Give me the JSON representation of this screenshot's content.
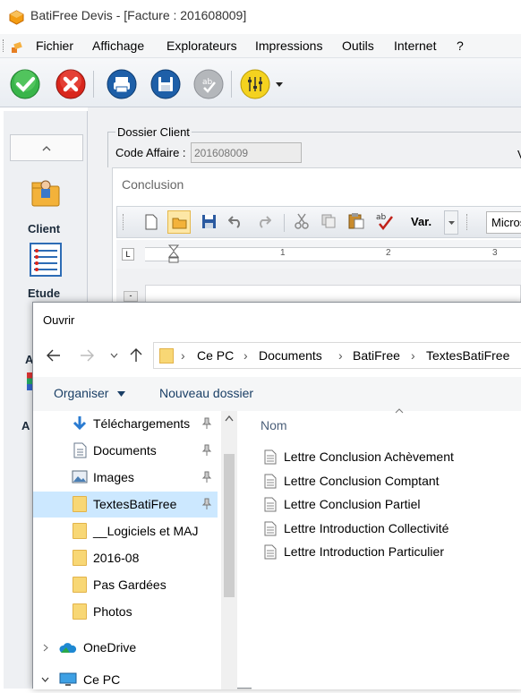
{
  "app": {
    "title": "BatiFree Devis - [Facture : 201608009]",
    "menu": [
      "Fichier",
      "Affichage",
      "Explorateurs",
      "Impressions",
      "Outils",
      "Internet",
      "?"
    ]
  },
  "left_nav": {
    "items": [
      {
        "label": "Client",
        "icon": "client-folder-icon"
      },
      {
        "label": "Etude",
        "icon": "etude-list-icon"
      }
    ],
    "partial_labels": [
      "A",
      "A"
    ]
  },
  "dossier": {
    "legend": "Dossier Client",
    "code_affaire_label": "Code Affaire :",
    "code_affaire_value": "201608009",
    "cut_letter": "V"
  },
  "conclusion": {
    "label": "Conclusion",
    "var_label": "Var.",
    "font_name": "Micros"
  },
  "ruler": {
    "marks": [
      "1",
      "2",
      "3"
    ],
    "corner": "L"
  },
  "dialog": {
    "title": "Ouvrir",
    "path": [
      "Ce PC",
      "Documents",
      "BatiFree",
      "TextesBatiFree"
    ],
    "organiser": "Organiser",
    "new_folder": "Nouveau dossier",
    "column_name": "Nom",
    "nav_items": [
      {
        "label": "Téléchargements",
        "icon": "download-icon",
        "pinned": true
      },
      {
        "label": "Documents",
        "icon": "documents-icon",
        "pinned": true
      },
      {
        "label": "Images",
        "icon": "images-icon",
        "pinned": true
      },
      {
        "label": "TextesBatiFree",
        "icon": "folder-icon",
        "pinned": true,
        "selected": true
      },
      {
        "label": "__Logiciels et MAJ",
        "icon": "folder-icon",
        "pinned": false
      },
      {
        "label": "2016-08",
        "icon": "folder-icon",
        "pinned": false
      },
      {
        "label": "Pas Gardées",
        "icon": "folder-icon",
        "pinned": false
      },
      {
        "label": "Photos",
        "icon": "folder-icon",
        "pinned": false
      }
    ],
    "tree_items": [
      {
        "label": "OneDrive",
        "icon": "onedrive-icon",
        "expanded": false
      },
      {
        "label": "Ce PC",
        "icon": "computer-icon",
        "expanded": true
      }
    ],
    "files": [
      "Lettre Conclusion Achèvement",
      "Lettre Conclusion Comptant",
      "Lettre Conclusion Partiel",
      "Lettre Introduction Collectivité",
      "Lettre Introduction Particulier"
    ]
  },
  "colors": {
    "selection": "#cce8ff",
    "accent_blue": "#1e5fa8",
    "ok_green": "#39b54a",
    "cancel_red": "#d9261c",
    "folder_yellow": "#f8d775"
  }
}
